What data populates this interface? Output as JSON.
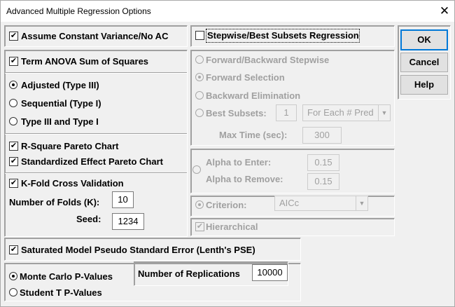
{
  "window": {
    "title": "Advanced Multiple Regression Options",
    "close_glyph": "✕"
  },
  "left": {
    "assume_constant_variance": {
      "label": "Assume Constant Variance/No AC",
      "checked": true
    },
    "term_anova": {
      "label": "Term ANOVA Sum of Squares",
      "checked": true
    },
    "ss_types": [
      {
        "label": "Adjusted (Type III)",
        "selected": true
      },
      {
        "label": "Sequential (Type I)",
        "selected": false
      },
      {
        "label": "Type III and Type I",
        "selected": false
      }
    ],
    "r_square_pareto": {
      "label": "R-Square Pareto Chart",
      "checked": true
    },
    "std_effect_pareto": {
      "label": "Standardized Effect Pareto Chart",
      "checked": true
    },
    "kfold": {
      "label": "K-Fold Cross Validation",
      "checked": true,
      "folds_label": "Number of Folds (K):",
      "folds_value": "10",
      "seed_label": "Seed:",
      "seed_value": "1234"
    }
  },
  "middle": {
    "stepwise": {
      "label": "Stepwise/Best Subsets Regression",
      "checked": false
    },
    "methods": [
      {
        "label": "Forward/Backward Stepwise",
        "selected": false
      },
      {
        "label": "Forward Selection",
        "selected": true
      },
      {
        "label": "Backward Elimination",
        "selected": false
      },
      {
        "label": "Best Subsets:",
        "selected": false
      }
    ],
    "best_subsets_value": "1",
    "best_subsets_combo": "For Each # Pred",
    "max_time_label": "Max Time (sec):",
    "max_time_value": "300",
    "alpha_enter_label": "Alpha to Enter:",
    "alpha_enter_value": "0.15",
    "alpha_remove_label": "Alpha to Remove:",
    "alpha_remove_value": "0.15",
    "criterion_label": "Criterion:",
    "criterion_value": "AICc",
    "hierarchical": {
      "label": "Hierarchical",
      "checked": true
    }
  },
  "buttons": {
    "ok": "OK",
    "cancel": "Cancel",
    "help": "Help"
  },
  "bottom": {
    "lenth": {
      "label": "Saturated Model Pseudo Standard Error (Lenth's PSE)",
      "checked": true
    },
    "pvalue_modes": [
      {
        "label": "Monte Carlo P-Values",
        "selected": true
      },
      {
        "label": "Student T P-Values",
        "selected": false
      }
    ],
    "replications_label": "Number of Replications",
    "replications_value": "10000"
  },
  "colors": {
    "focus_blue": "#0078d7",
    "disabled_text": "#a0a0a0",
    "window_bg": "#f0f0f0"
  }
}
